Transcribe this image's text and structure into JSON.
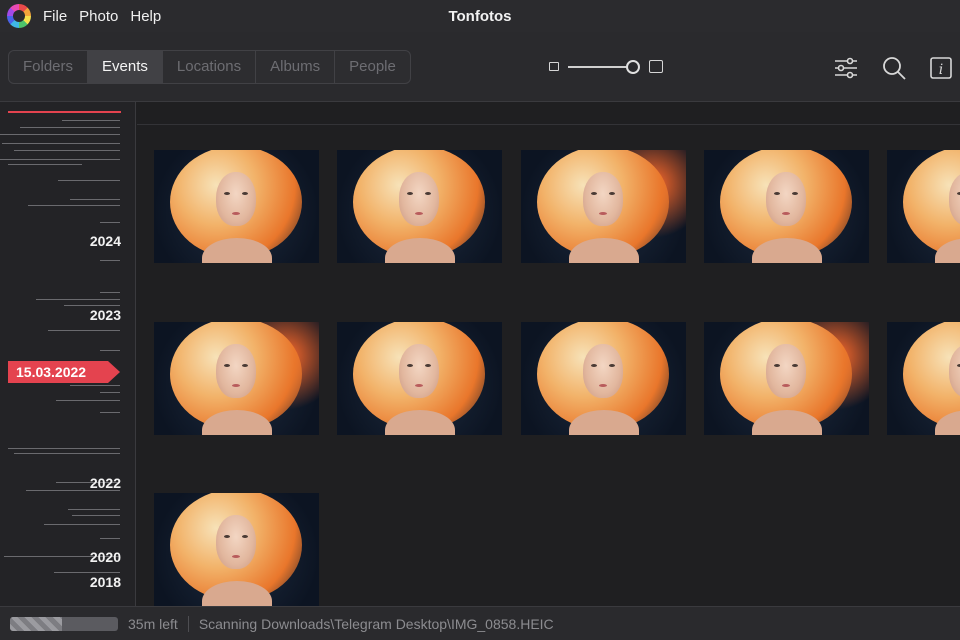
{
  "app": {
    "title": "Tonfotos"
  },
  "menu": [
    "File",
    "Photo",
    "Help"
  ],
  "tabs": [
    {
      "label": "Folders",
      "active": false
    },
    {
      "label": "Events",
      "active": true
    },
    {
      "label": "Locations",
      "active": false
    },
    {
      "label": "Albums",
      "active": false
    },
    {
      "label": "People",
      "active": false
    }
  ],
  "zoom": {
    "level": 0.95
  },
  "toolbar_icons": [
    "filter-sliders-icon",
    "search-icon",
    "info-icon"
  ],
  "timeline": {
    "years": [
      "2024",
      "2023",
      "2022",
      "2020",
      "2018"
    ],
    "current_date": "15.03.2022",
    "accent": "#e4434f"
  },
  "gallery": {
    "row_count": 3,
    "photos": [
      "photo",
      "photo",
      "photo",
      "photo",
      "photo",
      "photo",
      "photo",
      "photo",
      "photo",
      "photo",
      "photo"
    ]
  },
  "status": {
    "progress": 0.48,
    "time_left": "35m left",
    "message": "Scanning Downloads\\Telegram Desktop\\IMG_0858.HEIC"
  }
}
